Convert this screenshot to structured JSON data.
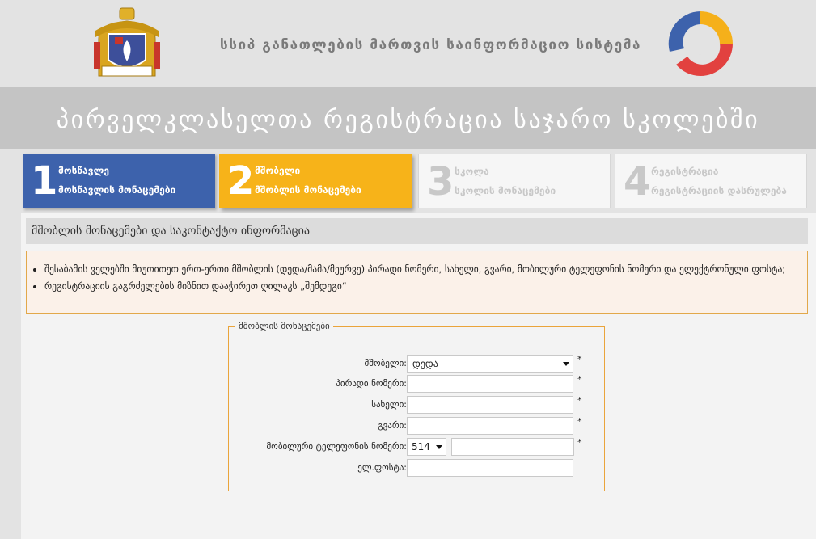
{
  "header": {
    "system_title": "სსიპ განათლების მართვის საინფორმაციო სისტემა",
    "banner_title": "პირველკლასელთა რეგისტრაცია საჯარო სკოლებში"
  },
  "steps": [
    {
      "number": "1",
      "title": "მოსწავლე",
      "subtitle": "მოსწავლის მონაცემები",
      "state": "completed",
      "color": "#3d62ac"
    },
    {
      "number": "2",
      "title": "მშობელი",
      "subtitle": "მშობლის მონაცემები",
      "state": "active",
      "color": "#f7b319"
    },
    {
      "number": "3",
      "title": "სკოლა",
      "subtitle": "სკოლის მონაცემები",
      "state": "inactive",
      "color": "#c8c8c8"
    },
    {
      "number": "4",
      "title": "რეგისტრაცია",
      "subtitle": "რეგისტრაციის დასრულება",
      "state": "inactive",
      "color": "#c8c8c8"
    }
  ],
  "section": {
    "heading": "მშობლის მონაცემები და საკონტაქტო ინფორმაცია",
    "info": [
      "შესაბამის ველებში მიუთითეთ ერთ-ერთი მშობლის (დედა/მამა/მეურვე) პირადი ნომერი, სახელი, გვარი, მობილური ტელეფონის ნომერი და ელექტრონული ფოსტა;",
      "რეგისტრაციის გაგრძელების მიზნით დააჭირეთ ღილაკს „შემდეგი“"
    ]
  },
  "form": {
    "legend": "მშობლის მონაცემები",
    "required_mark": "*",
    "parent": {
      "label": "მშობელი:",
      "value": "დედა"
    },
    "personal_id": {
      "label": "პირადი ნომერი:",
      "value": ""
    },
    "first_name": {
      "label": "სახელი:",
      "value": ""
    },
    "last_name": {
      "label": "გვარი:",
      "value": ""
    },
    "mobile": {
      "label": "მობილური ტელეფონის ნომერი:",
      "prefix": "514",
      "value": ""
    },
    "email": {
      "label": "ელ.ფოსტა:",
      "value": ""
    }
  }
}
